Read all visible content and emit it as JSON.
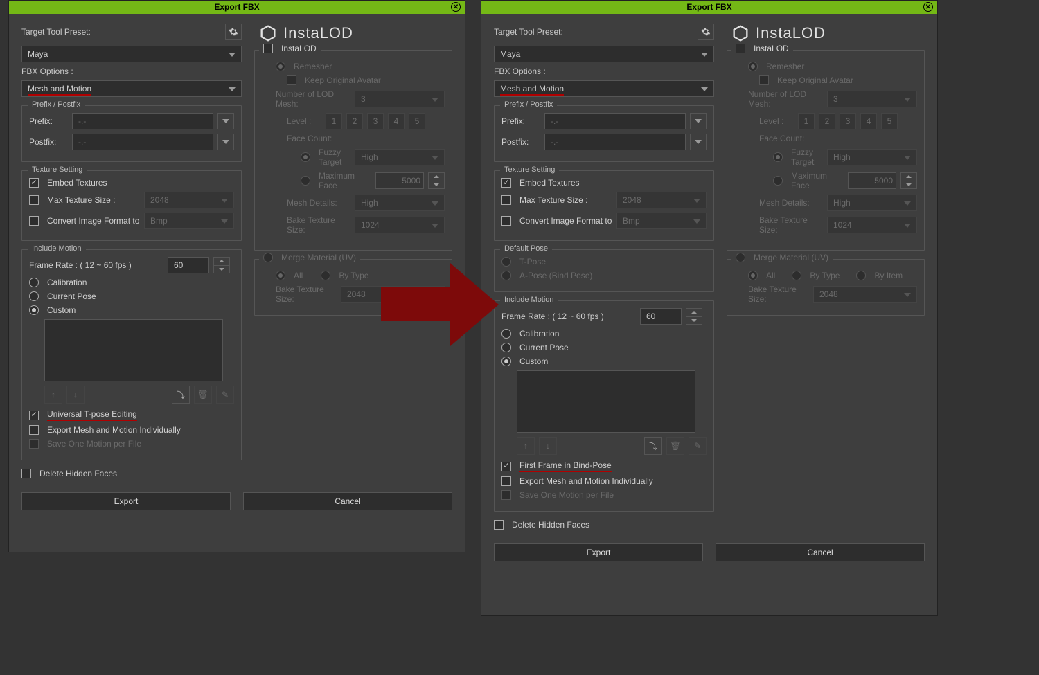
{
  "window_title": "Export FBX",
  "targetPresetLabel": "Target Tool Preset:",
  "targetPresetValue": "Maya",
  "fbxOptionsLabel": "FBX Options :",
  "fbxOptionsValue": "Mesh and Motion",
  "prefixPostfix": {
    "legend": "Prefix / Postfix",
    "prefixLabel": "Prefix:",
    "postfixLabel": "Postfix:",
    "placeholder": "-.-"
  },
  "textureSetting": {
    "legend": "Texture Setting",
    "embed": "Embed Textures",
    "maxSize": "Max Texture Size :",
    "maxSizeVal": "2048",
    "convert": "Convert Image Format to",
    "convertVal": "Bmp"
  },
  "defaultPose": {
    "legend": "Default Pose",
    "tpose": "T-Pose",
    "apose": "A-Pose (Bind Pose)"
  },
  "includeMotion": {
    "legend": "Include Motion",
    "frameRate": "Frame Rate : ( 12 ~ 60 fps )",
    "frameRateVal": "60",
    "calibration": "Calibration",
    "currentPose": "Current Pose",
    "custom": "Custom",
    "utpose": "Universal T-pose Editing",
    "firstFrame": "First Frame in Bind-Pose",
    "exportIndividually": "Export Mesh and Motion Individually",
    "saveOne": "Save One Motion per File"
  },
  "deleteHiddenFaces": "Delete Hidden Faces",
  "exportBtn": "Export",
  "cancelBtn": "Cancel",
  "brand": {
    "name": "InstaLOD"
  },
  "instalod": {
    "checkbox": "InstaLOD",
    "remesher": "Remesher",
    "keepAvatar": "Keep Original Avatar",
    "numLOD": "Number of LOD Mesh:",
    "numLODVal": "3",
    "levelLabel": "Level :",
    "levels": [
      "1",
      "2",
      "3",
      "4",
      "5"
    ],
    "faceCount": "Face Count:",
    "fuzzy": "Fuzzy Target",
    "fuzzyVal": "High",
    "maxFace": "Maximum Face",
    "maxFaceVal": "5000",
    "meshDetails": "Mesh Details:",
    "meshDetailsVal": "High",
    "bakeTexSize": "Bake Texture Size:",
    "bakeTexVal": "1024",
    "merge": "Merge Material (UV)",
    "all": "All",
    "byType": "By Type",
    "byItem": "By Item",
    "mergeBake": "Bake Texture Size:",
    "mergeBakeVal": "2048"
  }
}
